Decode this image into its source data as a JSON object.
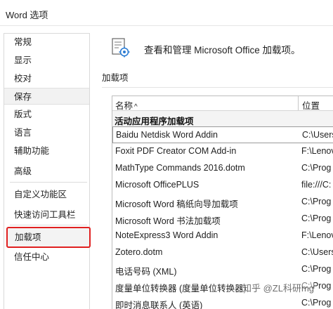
{
  "window": {
    "title": "Word 选项"
  },
  "sidebar": {
    "items": [
      {
        "label": "常规"
      },
      {
        "label": "显示"
      },
      {
        "label": "校对"
      },
      {
        "label": "保存"
      },
      {
        "label": "版式"
      },
      {
        "label": "语言"
      },
      {
        "label": "辅助功能"
      },
      {
        "label": "高级"
      },
      {
        "label": "自定义功能区"
      },
      {
        "label": "快速访问工具栏"
      },
      {
        "label": "加载项"
      },
      {
        "label": "信任中心"
      }
    ],
    "active_index": 10
  },
  "main": {
    "header_text": "查看和管理 Microsoft Office 加载项。",
    "header_icon": "addins-gear-icon",
    "section_label": "加载项",
    "table": {
      "columns": [
        "名称",
        "位置"
      ],
      "sort_indicator": "^",
      "group_label": "活动应用程序加载项",
      "rows": [
        {
          "name": "Baidu Netdisk Word Addin",
          "location": "C:\\Users"
        },
        {
          "name": "Foxit PDF Creator COM Add-in",
          "location": "F:\\Lenov"
        },
        {
          "name": "MathType Commands 2016.dotm",
          "location": "C:\\Prog"
        },
        {
          "name": "Microsoft OfficePLUS",
          "location": "file:///C:"
        },
        {
          "name": "Microsoft Word 稿纸向导加载项",
          "location": "C:\\Prog"
        },
        {
          "name": "Microsoft Word 书法加载项",
          "location": "C:\\Prog"
        },
        {
          "name": "NoteExpress3 Word Addin",
          "location": "F:\\Lenov"
        },
        {
          "name": "Zotero.dotm",
          "location": "C:\\Users"
        },
        {
          "name": "电话号码 (XML)",
          "location": "C:\\Prog"
        },
        {
          "name": "度量单位转换器 (度量单位转换器)",
          "location": "C:\\Prog"
        },
        {
          "name": "即时消息联系人 (英语)",
          "location": "C:\\Prog"
        }
      ]
    }
  },
  "watermark": {
    "text": "知乎 @ZL科研mg"
  },
  "colors": {
    "active_border": "#e02020",
    "group_bg": "#f4f4f4"
  }
}
